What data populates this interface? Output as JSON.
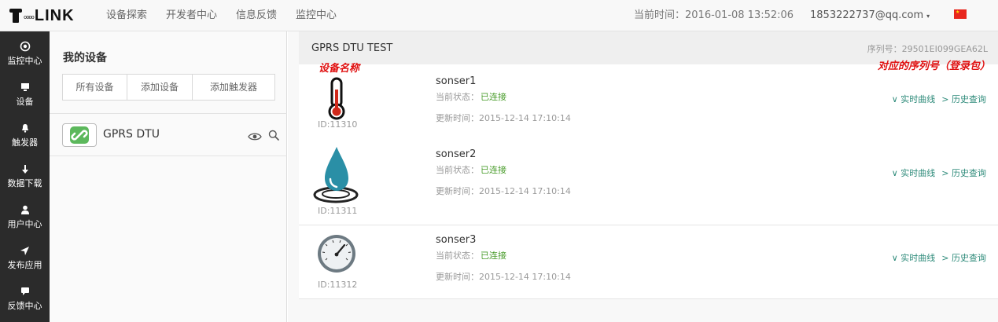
{
  "app": {
    "logo_dots": "oooo",
    "logo_text": "LINK"
  },
  "nav": [
    "设备探索",
    "开发者中心",
    "信息反馈",
    "监控中心"
  ],
  "header": {
    "clock": "当前时间：2016-01-08 13:52:06",
    "account": "1853222737@qq.com",
    "account_caret": "▾",
    "flag_color": "#e8271e"
  },
  "sidebar": {
    "items": [
      {
        "label": "监控中心",
        "icon": "target-icon"
      },
      {
        "label": "设备",
        "icon": "monitor-icon"
      },
      {
        "label": "触发器",
        "icon": "bell-icon"
      },
      {
        "label": "数据下载",
        "icon": "download-icon"
      },
      {
        "label": "用户中心",
        "icon": "user-icon"
      },
      {
        "label": "发布应用",
        "icon": "send-icon"
      },
      {
        "label": "反馈中心",
        "icon": "comment-icon"
      }
    ]
  },
  "device_panel": {
    "title": "我的设备",
    "buttons": [
      "所有设备",
      "添加设备",
      "添加触发器"
    ],
    "device": {
      "name": "GPRS DTU"
    }
  },
  "main": {
    "title": "GPRS DTU TEST",
    "serial": "序列号：29501EI099GEA62L",
    "annotation_name": "设备名称",
    "annotation_serial": "对应的序列号（登录包）",
    "accent_color": "#2e8b7a",
    "status_color": "#4a9d2c"
  },
  "sensors": [
    {
      "id": "ID:11310",
      "name": "sonser1",
      "status_label": "当前状态：",
      "status": "已连接",
      "updated": "更新时间：2015-12-14 17:10:14",
      "icon": "thermometer-icon",
      "link_realtime": "∨ 实时曲线",
      "link_history": "> 历史查询"
    },
    {
      "id": "ID:11311",
      "name": "sonser2",
      "status_label": "当前状态：",
      "status": "已连接",
      "updated": "更新时间：2015-12-14 17:10:14",
      "icon": "water-drop-icon",
      "link_realtime": "∨ 实时曲线",
      "link_history": "> 历史查询"
    },
    {
      "id": "ID:11312",
      "name": "sonser3",
      "status_label": "当前状态：",
      "status": "已连接",
      "updated": "更新时间：2015-12-14 17:10:14",
      "icon": "pressure-gauge-icon",
      "link_realtime": "∨ 实时曲线",
      "link_history": "> 历史查询"
    }
  ]
}
